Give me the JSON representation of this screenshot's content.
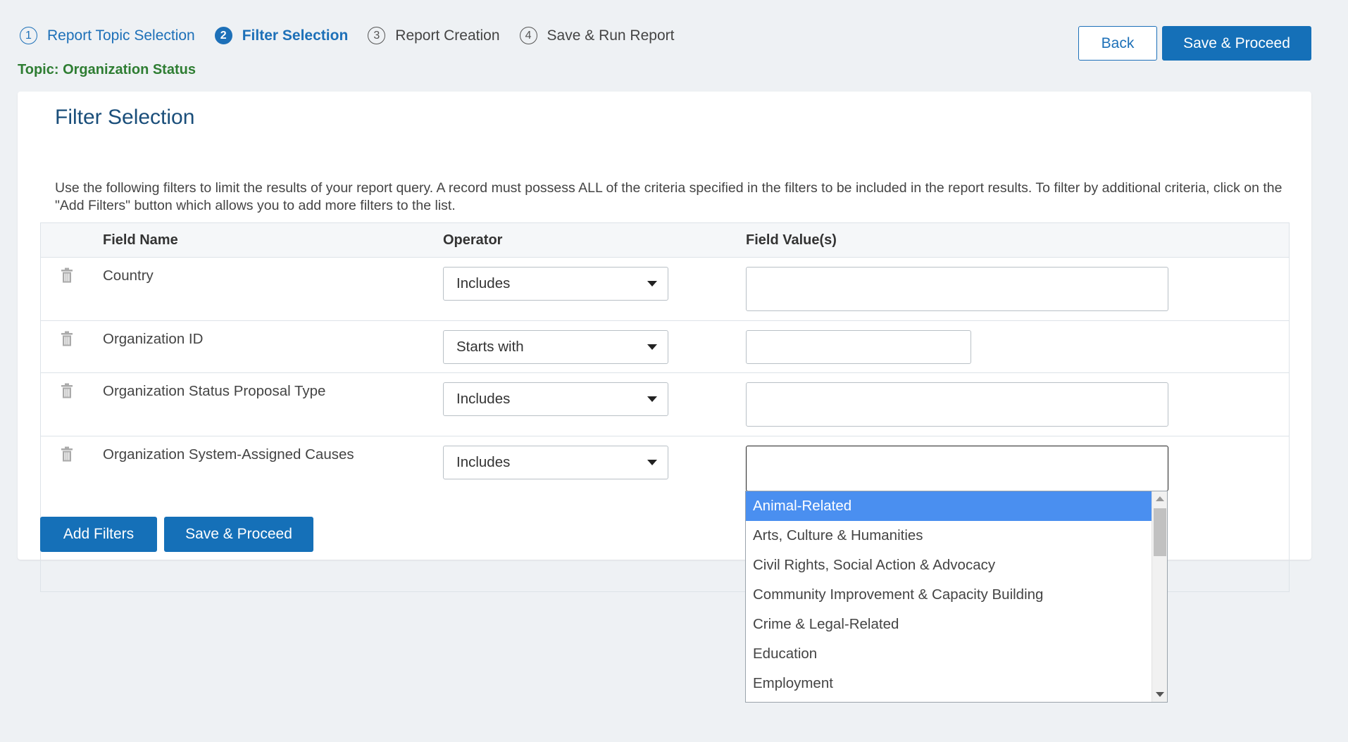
{
  "wizard": {
    "steps": [
      {
        "num": "1",
        "label": "Report Topic Selection",
        "state": "done"
      },
      {
        "num": "2",
        "label": "Filter Selection",
        "state": "active"
      },
      {
        "num": "3",
        "label": "Report Creation",
        "state": "pending"
      },
      {
        "num": "4",
        "label": "Save & Run Report",
        "state": "pending"
      }
    ]
  },
  "topic": "Topic: Organization Status",
  "header": {
    "back_label": "Back",
    "save_proceed_label": "Save & Proceed"
  },
  "card": {
    "title": "Filter Selection",
    "description": "Use the following filters to limit the results of your report query. A record must possess ALL of the criteria specified in the filters to be included in the report results. To filter by additional criteria, click on the \"Add Filters\" button which allows you to add more filters to the list."
  },
  "table": {
    "headers": {
      "field_name": "Field Name",
      "operator": "Operator",
      "field_values": "Field Value(s)"
    },
    "rows": [
      {
        "field": "Country",
        "operator": "Includes",
        "value": ""
      },
      {
        "field": "Organization ID",
        "operator": "Starts with",
        "value": ""
      },
      {
        "field": "Organization Status Proposal Type",
        "operator": "Includes",
        "value": ""
      },
      {
        "field": "Organization System-Assigned Causes",
        "operator": "Includes",
        "value": ""
      }
    ]
  },
  "actions": {
    "add_filters_label": "Add Filters",
    "save_proceed_label": "Save & Proceed"
  },
  "dropdown": {
    "selected_index": 0,
    "options": [
      "Animal-Related",
      "Arts, Culture & Humanities",
      "Civil Rights, Social Action & Advocacy",
      "Community Improvement & Capacity Building",
      "Crime & Legal-Related",
      "Education",
      "Employment"
    ]
  },
  "colors": {
    "accent": "#1570b8",
    "topic_green": "#2e7d32",
    "dropdown_highlight": "#4a8ff0"
  }
}
